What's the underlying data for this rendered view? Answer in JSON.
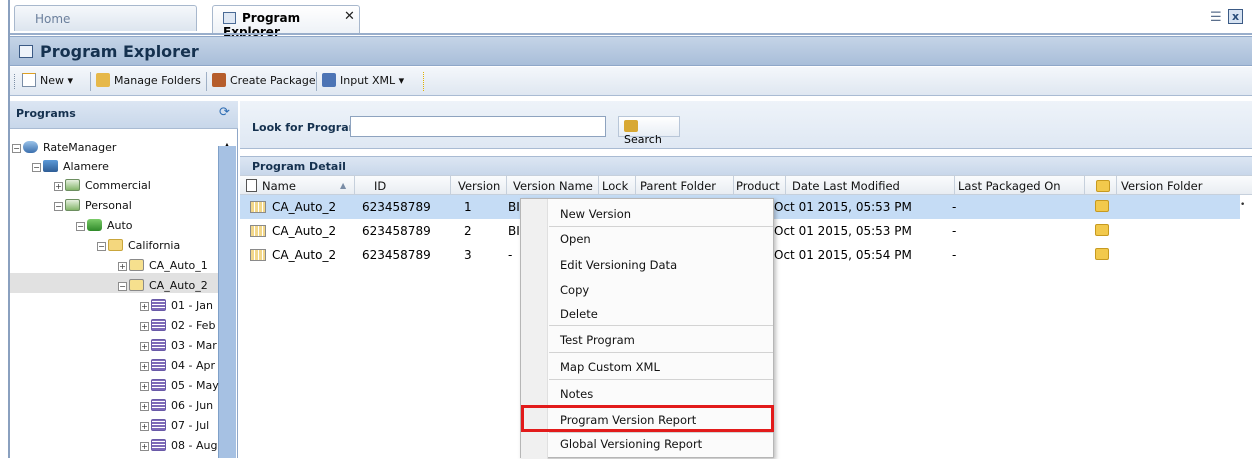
{
  "tabs": {
    "home": "Home",
    "program_explorer": "Program Explorer",
    "close": "✕"
  },
  "window": {
    "title": "Program Explorer"
  },
  "toolbar": {
    "new": "New ▾",
    "manage_folders": "Manage Folders",
    "create_package": "Create Package",
    "input_xml": "Input XML ▾"
  },
  "left": {
    "title": "Programs",
    "tree": [
      {
        "label": "RateManager",
        "icon": "server-icon"
      },
      {
        "label": "Alamere",
        "icon": "org-icon"
      },
      {
        "label": "Commercial",
        "icon": "line-icon"
      },
      {
        "label": "Personal",
        "icon": "line-icon"
      },
      {
        "label": "Auto",
        "icon": "product-icon"
      },
      {
        "label": "California",
        "icon": "folder-icon"
      },
      {
        "label": "CA_Auto_1",
        "icon": "program-icon"
      },
      {
        "label": "CA_Auto_2",
        "icon": "program-icon"
      },
      {
        "label": "01 - Jan",
        "icon": "version-icon"
      },
      {
        "label": "02 - Feb",
        "icon": "version-icon"
      },
      {
        "label": "03 - Mar",
        "icon": "version-icon"
      },
      {
        "label": "04 - Apr",
        "icon": "version-icon"
      },
      {
        "label": "05 - May",
        "icon": "version-icon"
      },
      {
        "label": "06 - Jun",
        "icon": "version-icon"
      },
      {
        "label": "07 - Jul",
        "icon": "version-icon"
      },
      {
        "label": "08 - Aug",
        "icon": "version-icon"
      }
    ]
  },
  "search": {
    "label": "Look for Program:",
    "value": "",
    "button": "Search"
  },
  "detail": {
    "title": "Program Detail",
    "columns": [
      "Name",
      "ID",
      "Version",
      "Version Name",
      "Lock",
      "Parent Folder",
      "Product",
      "Date Last Modified",
      "Last Packaged On",
      "Version Folder"
    ],
    "rows": [
      {
        "name": "CA_Auto_2",
        "id": "623458789",
        "version": "1",
        "version_name": "BI R",
        "date": "Oct 01 2015, 05:53 PM",
        "packaged": "-"
      },
      {
        "name": "CA_Auto_2",
        "id": "623458789",
        "version": "2",
        "version_name": "BI R",
        "date": "Oct 01 2015, 05:53 PM",
        "packaged": "-"
      },
      {
        "name": "CA_Auto_2",
        "id": "623458789",
        "version": "3",
        "version_name": "-",
        "date": "Oct 01 2015, 05:54 PM",
        "packaged": "-"
      }
    ]
  },
  "context_menu": {
    "items": [
      "New Version",
      "Open",
      "Edit Versioning Data",
      "Copy",
      "Delete",
      "Test Program",
      "Map Custom XML",
      "Notes",
      "Program Version Report",
      "Global Versioning Report"
    ],
    "highlighted": "Program Version Report",
    "highlight_color": "#e21b1b"
  },
  "colors": {
    "selected_row": "#c5dcf5",
    "title_bar": "#b8cbe2"
  }
}
